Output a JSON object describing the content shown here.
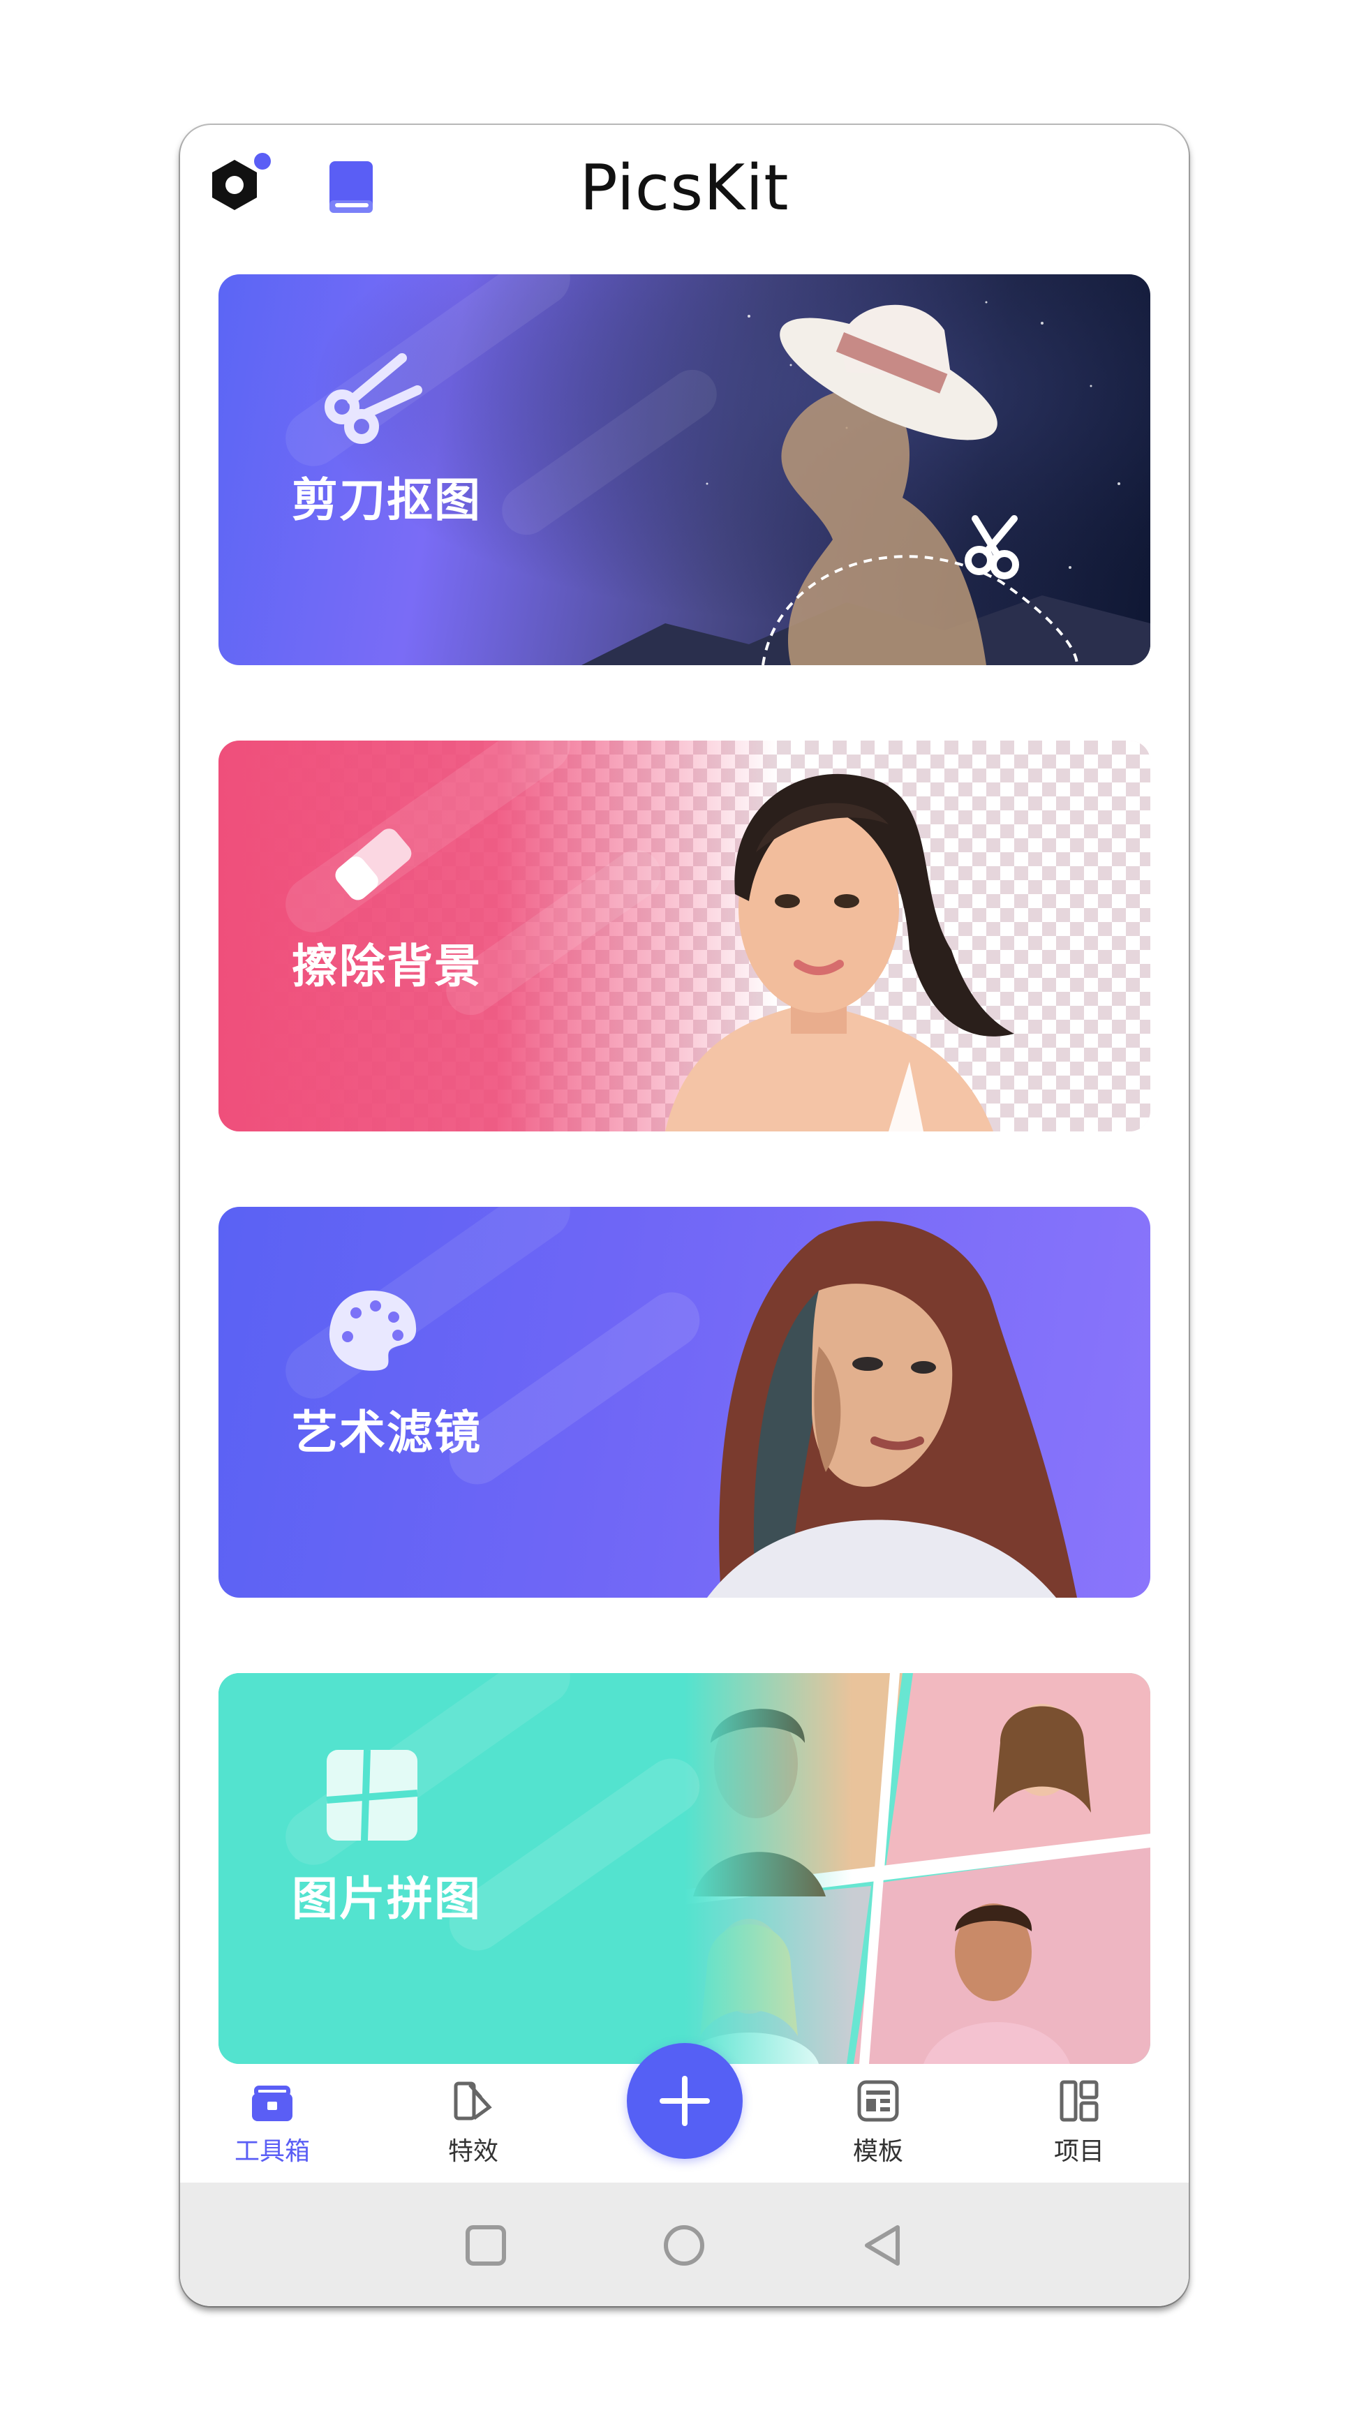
{
  "header": {
    "title": "PicsKit",
    "settings_icon": "hexagon-settings-icon",
    "book_icon": "book-icon",
    "notification_dot_color": "#5a5ef5"
  },
  "cards": [
    {
      "label": "剪刀抠图",
      "icon": "scissors-icon"
    },
    {
      "label": "擦除背景",
      "icon": "eraser-icon"
    },
    {
      "label": "艺术滤镜",
      "icon": "palette-icon"
    },
    {
      "label": "图片拼图",
      "icon": "collage-icon"
    }
  ],
  "bottom_nav": {
    "items": [
      {
        "label": "工具箱",
        "icon": "toolbox-icon",
        "active": true
      },
      {
        "label": "特效",
        "icon": "effects-icon",
        "active": false
      },
      {
        "label": "模板",
        "icon": "template-icon",
        "active": false
      },
      {
        "label": "项目",
        "icon": "projects-icon",
        "active": false
      }
    ],
    "fab_icon": "plus-icon",
    "accent_color": "#5a5ef5"
  },
  "system_nav": {
    "icons": [
      "square-recents-icon",
      "circle-home-icon",
      "triangle-back-icon"
    ]
  }
}
